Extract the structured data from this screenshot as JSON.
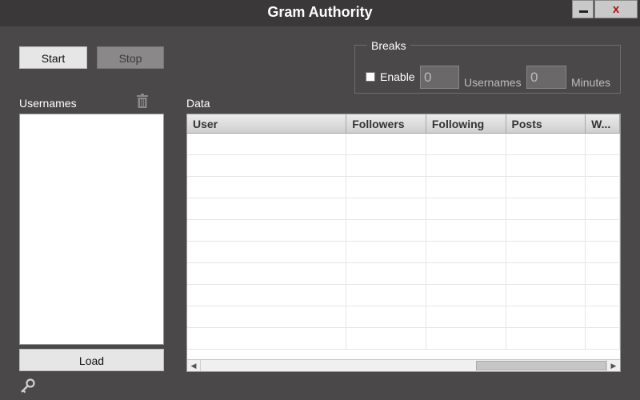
{
  "window": {
    "title": "Gram Authority",
    "close_label": "x"
  },
  "controls": {
    "start_label": "Start",
    "stop_label": "Stop",
    "load_label": "Load"
  },
  "breaks": {
    "legend": "Breaks",
    "enable_label": "Enable",
    "enable_checked": false,
    "usernames_value": "0",
    "usernames_unit": "Usernames",
    "minutes_value": "0",
    "minutes_unit": "Minutes"
  },
  "usernames": {
    "label": "Usernames",
    "items": []
  },
  "data_table": {
    "label": "Data",
    "columns": [
      "User",
      "Followers",
      "Following",
      "Posts",
      "W..."
    ],
    "rows": []
  },
  "icons": {
    "delete": "trash-icon",
    "settings": "key-icon"
  }
}
